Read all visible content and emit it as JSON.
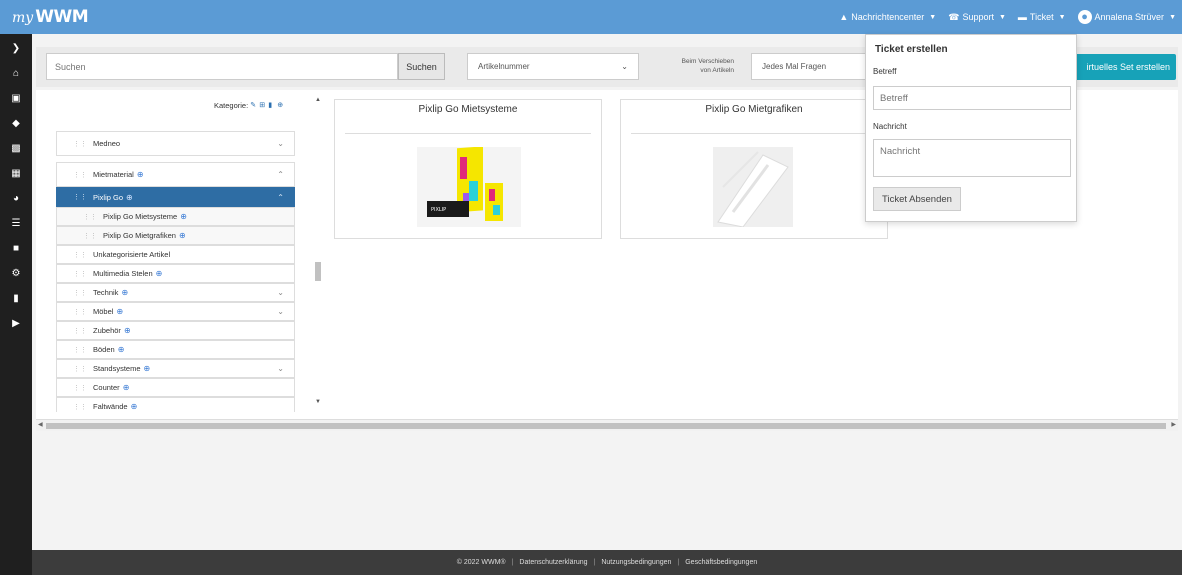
{
  "header": {
    "logo_my": "my",
    "logo_brand": "WWM",
    "nav": [
      {
        "label": "Nachrichtencenter",
        "icon": "bell-icon"
      },
      {
        "label": "Support",
        "icon": "phone-icon"
      },
      {
        "label": "Ticket",
        "icon": "envelope-icon"
      },
      {
        "label": "Annalena Strüver",
        "icon": "user-icon"
      }
    ]
  },
  "sidebar": {
    "icons": [
      "chevron-right-icon",
      "home-icon",
      "cart-icon",
      "tag-icon",
      "sitemap-icon",
      "calendar-icon",
      "pie-chart-icon",
      "list-icon",
      "industry-icon",
      "gear-icon",
      "file-icon",
      "video-icon"
    ]
  },
  "toolbar": {
    "search_placeholder": "Suchen",
    "search_button": "Suchen",
    "field_select": "Artikelnummer",
    "move_label_line1": "Beim Verschieben",
    "move_label_line2": "von Artikeln",
    "move_select": "Jedes Mal Fragen",
    "virtual_set_button": "irtuelles Set erstellen"
  },
  "category": {
    "header_label": "Kategorie:"
  },
  "tree": [
    {
      "label": "Medneo",
      "has_globe": false,
      "expandable": true,
      "state": "collapsed"
    },
    {
      "label": "Mietmaterial",
      "has_globe": true,
      "expandable": true,
      "state": "expanded"
    },
    {
      "label": "Pixlip Go",
      "has_globe": true,
      "expandable": true,
      "state": "active"
    },
    {
      "label": "Pixlip Go Mietsysteme",
      "has_globe": true,
      "child": true
    },
    {
      "label": "Pixlip Go Mietgrafiken",
      "has_globe": true,
      "child": true
    },
    {
      "label": "Unkategorisierte Artikel",
      "has_globe": false
    },
    {
      "label": "Multimedia Stelen",
      "has_globe": true
    },
    {
      "label": "Technik",
      "has_globe": true,
      "expandable": true
    },
    {
      "label": "Möbel",
      "has_globe": true,
      "expandable": true
    },
    {
      "label": "Zubehör",
      "has_globe": true
    },
    {
      "label": "Böden",
      "has_globe": true
    },
    {
      "label": "Standsysteme",
      "has_globe": true,
      "expandable": true
    },
    {
      "label": "Counter",
      "has_globe": true
    },
    {
      "label": "Faltwände",
      "has_globe": true
    }
  ],
  "products": [
    {
      "title": "Pixlip Go Mietsysteme",
      "image_label": "PIXLIP"
    },
    {
      "title": "Pixlip Go Mietgrafiken"
    }
  ],
  "ticket": {
    "title": "Ticket erstellen",
    "subject_label": "Betreff",
    "subject_placeholder": "Betreff",
    "message_label": "Nachricht",
    "message_placeholder": "Nachricht",
    "send_button": "Ticket Absenden"
  },
  "footer": {
    "copyright": "© 2022 WWM®",
    "links": [
      "Datenschutzerklärung",
      "Nutzungsbedingungen",
      "Geschäftsbedingungen"
    ]
  },
  "colors": {
    "header": "#5b9bd5",
    "sidebar": "#1f1f1f",
    "active_row": "#2e6da4",
    "accent_button": "#17a2b8",
    "footer": "#3c3c3c"
  }
}
